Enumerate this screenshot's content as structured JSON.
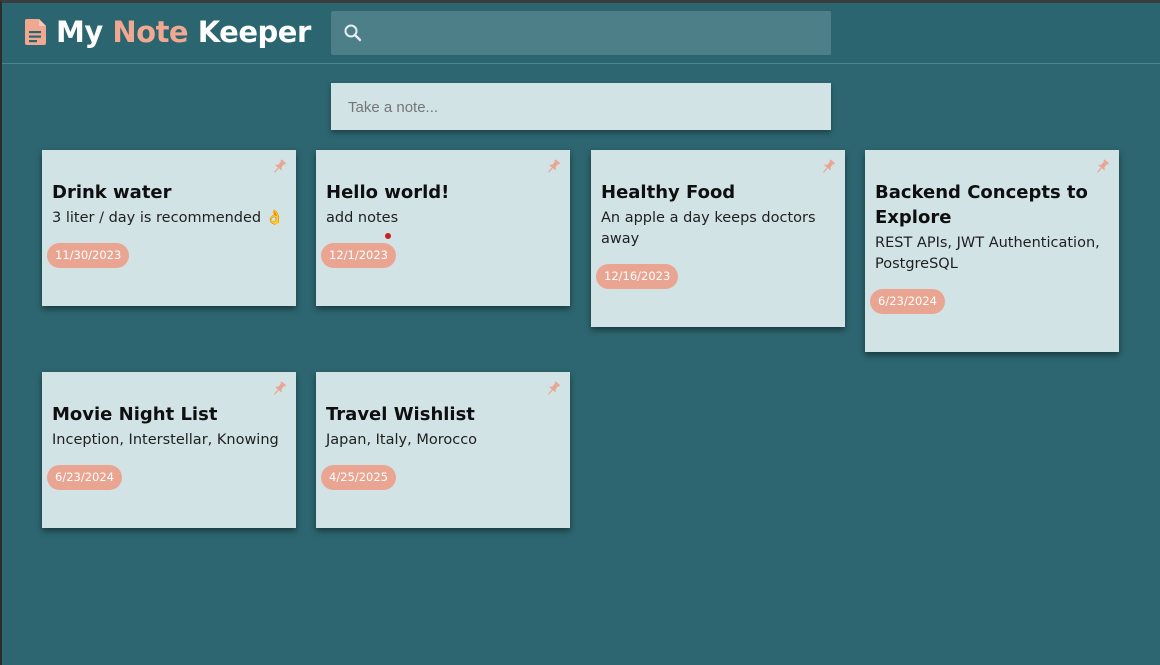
{
  "app": {
    "title_part1": "My",
    "title_part2": "Note",
    "title_part3": "Keeper",
    "logo_icon": "note-document-icon",
    "accent_color": "#f0a891"
  },
  "search": {
    "placeholder": "",
    "value": "",
    "icon": "search-icon"
  },
  "composer": {
    "placeholder": "Take a note..."
  },
  "notes": [
    {
      "title": "Drink water",
      "body": "3 liter / day is recommended 👌",
      "date": "11/30/2023",
      "pin_icon": "pin-icon"
    },
    {
      "title": "Hello world!",
      "body": "add notes",
      "date": "12/1/2023",
      "pin_icon": "pin-icon"
    },
    {
      "title": "Healthy Food",
      "body": "An apple a day keeps doctors away",
      "date": "12/16/2023",
      "pin_icon": "pin-icon"
    },
    {
      "title": "Backend Concepts to Explore",
      "body": "REST APIs, JWT Authentication, PostgreSQL",
      "date": "6/23/2024",
      "pin_icon": "pin-icon"
    },
    {
      "title": "Movie Night List",
      "body": "Inception, Interstellar, Knowing",
      "date": "6/23/2024",
      "pin_icon": "pin-icon"
    },
    {
      "title": "Travel Wishlist",
      "body": "Japan, Italy, Morocco",
      "date": "4/25/2025",
      "pin_icon": "pin-icon"
    }
  ],
  "colors": {
    "background": "#2d6670",
    "card": "#d2e3e5",
    "date_badge": "#e9a591",
    "pin": "#e9a591"
  }
}
